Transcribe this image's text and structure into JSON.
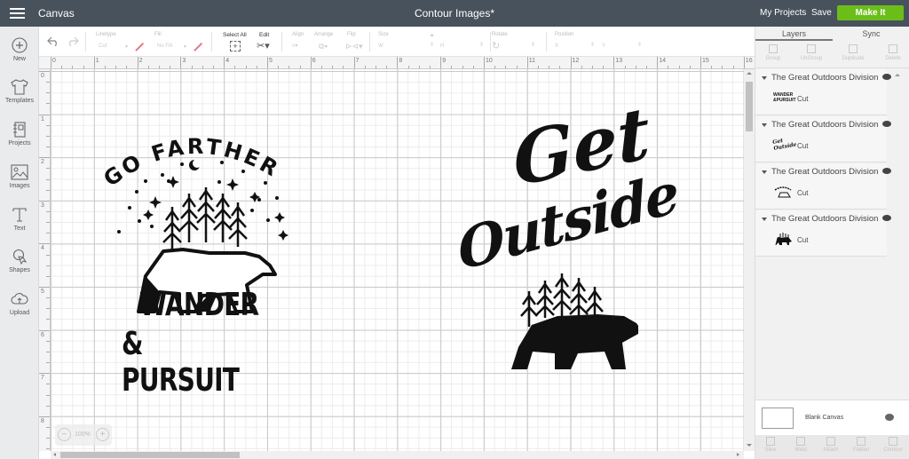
{
  "topbar": {
    "app_title": "Canvas",
    "doc_title": "Contour Images*",
    "my_projects": "My Projects",
    "save": "Save",
    "make_it": "Make It",
    "accent_color": "#6bbe1a"
  },
  "leftbar": {
    "items": [
      {
        "label": "New",
        "icon": "plus-circle-icon"
      },
      {
        "label": "Templates",
        "icon": "shirt-icon"
      },
      {
        "label": "Projects",
        "icon": "notebook-icon"
      },
      {
        "label": "Images",
        "icon": "image-icon"
      },
      {
        "label": "Text",
        "icon": "text-t-icon"
      },
      {
        "label": "Shapes",
        "icon": "shapes-icon"
      },
      {
        "label": "Upload",
        "icon": "cloud-upload-icon"
      }
    ]
  },
  "toolbar": {
    "linetype_label": "Linetype",
    "linetype_value": "Cut",
    "fill_label": "Fill",
    "fill_value": "No Fill",
    "select_all": "Select All",
    "edit": "Edit",
    "align": "Align",
    "arrange": "Arrange",
    "flip": "Flip",
    "size": "Size",
    "size_w": "W",
    "size_h": "H",
    "rotate": "Rotate",
    "position": "Position",
    "pos_x": "X",
    "pos_y": "Y"
  },
  "rulers": {
    "horizontal": [
      "0",
      "1",
      "2",
      "3",
      "4",
      "5",
      "6",
      "7",
      "8",
      "9",
      "10",
      "11",
      "12",
      "13",
      "14",
      "15",
      "16"
    ],
    "vertical": [
      "0",
      "1",
      "2",
      "3",
      "4",
      "5",
      "6",
      "7",
      "8"
    ]
  },
  "canvas": {
    "zoom": "100%",
    "design_left": {
      "top_text": "GO FARTHER",
      "line1": "WANDER",
      "line2": "& PURSUIT"
    },
    "design_right": {
      "line1": "Get",
      "line2": "Outside"
    }
  },
  "right_panel": {
    "tabs": [
      "Layers",
      "Sync"
    ],
    "tools": [
      "Group",
      "UnGroup",
      "Duplicate",
      "Delete"
    ],
    "layers": [
      {
        "name": "The Great Outdoors Division",
        "operation": "Cut",
        "thumb": "wander-pursuit"
      },
      {
        "name": "The Great Outdoors Division",
        "operation": "Cut",
        "thumb": "get-outside"
      },
      {
        "name": "The Great Outdoors Division",
        "operation": "Cut",
        "thumb": "go-farther"
      },
      {
        "name": "The Great Outdoors Division",
        "operation": "Cut",
        "thumb": "bear"
      }
    ],
    "blank_canvas": "Blank Canvas",
    "bottom_tools": [
      "Slice",
      "Weld",
      "Attach",
      "Flatten",
      "Contour"
    ]
  }
}
